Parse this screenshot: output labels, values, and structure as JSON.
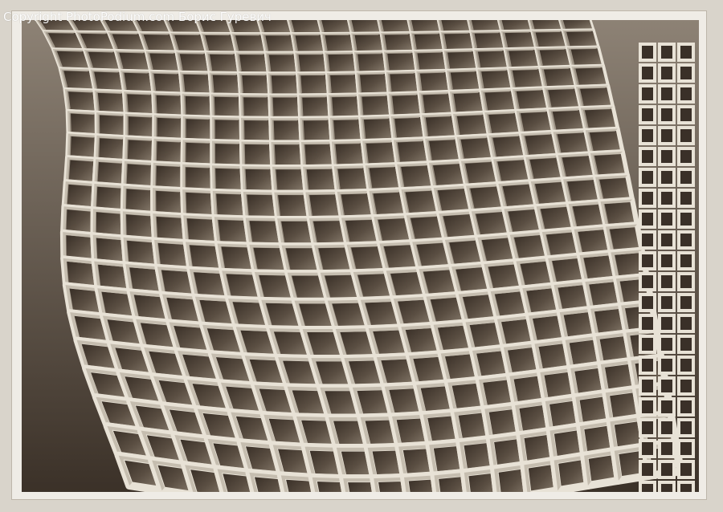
{
  "photo": {
    "subject": "building-facade",
    "watermark": "Copyright PhotoPodium.com Борис Гуревич"
  },
  "colors": {
    "background": "#d9d4cb",
    "frame": "#efece6",
    "concrete_light": "#e8e2d6",
    "concrete_mid": "#b9b0a2",
    "window_dark": "#3e342b"
  }
}
